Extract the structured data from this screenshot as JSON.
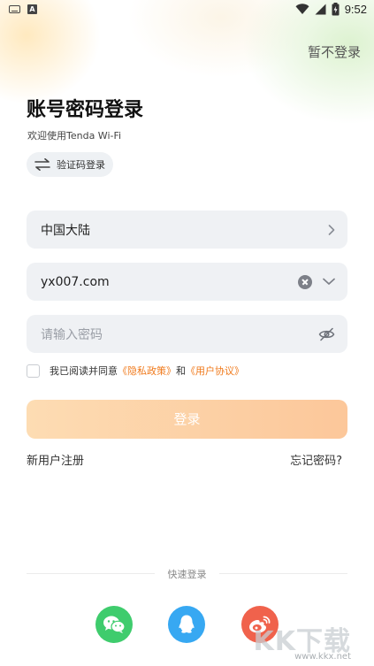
{
  "status_bar": {
    "time": "9:52",
    "icons": [
      "keyboard-icon",
      "a-icon",
      "wifi-icon",
      "signal-icon",
      "battery-icon"
    ]
  },
  "header": {
    "skip_label": "暂不登录"
  },
  "login": {
    "title": "账号密码登录",
    "subtitle": "欢迎使用Tenda Wi-Fi",
    "switch_label": "验证码登录"
  },
  "form": {
    "region_value": "中国大陆",
    "account_value": "yx007.com",
    "password_placeholder": "请输入密码"
  },
  "agreement": {
    "prefix": "我已阅读并同意",
    "privacy": "《隐私政策》",
    "and": "和",
    "terms": "《用户协议》",
    "checked": false
  },
  "actions": {
    "login_label": "登录",
    "register_label": "新用户注册",
    "forgot_label": "忘记密码?"
  },
  "quick_login": {
    "label": "快速登录",
    "providers": [
      "wechat-icon",
      "qq-icon",
      "weibo-icon"
    ]
  },
  "watermark": {
    "text": "KK下载",
    "url": "www.kkx.net"
  },
  "colors": {
    "accent": "#f07a1c",
    "button_gradient_start": "#fddcb3",
    "button_gradient_end": "#fcc79a",
    "field_bg": "#eff1f4",
    "wechat": "#3fcc6d",
    "qq": "#37a8f2",
    "weibo": "#f0624c"
  }
}
